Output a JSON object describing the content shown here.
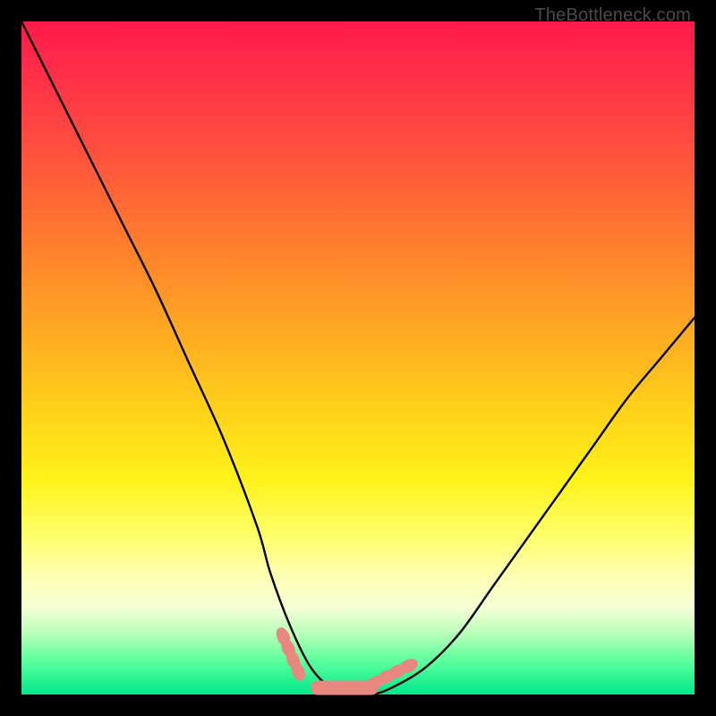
{
  "watermark": "TheBottleneck.com",
  "chart_data": {
    "type": "line",
    "title": "",
    "xlabel": "",
    "ylabel": "",
    "xlim": [
      0,
      100
    ],
    "ylim": [
      0,
      100
    ],
    "series": [
      {
        "name": "bottleneck-curve",
        "x": [
          0,
          5,
          10,
          15,
          20,
          25,
          30,
          35,
          37,
          40,
          43,
          46,
          49,
          52,
          55,
          60,
          65,
          70,
          75,
          80,
          85,
          90,
          95,
          100
        ],
        "values": [
          100,
          90,
          80,
          70,
          60,
          49,
          38,
          25,
          18,
          10,
          4,
          1,
          0,
          0,
          1,
          4,
          9,
          16,
          23,
          30,
          37,
          44,
          50,
          56
        ]
      }
    ],
    "markers": [
      {
        "name": "left-cluster",
        "x": 40,
        "y": 6
      },
      {
        "name": "right-cluster",
        "x": 55,
        "y": 3
      }
    ],
    "flat_segment": {
      "x_start": 43,
      "x_end": 53,
      "y": 1
    },
    "background_gradient": {
      "top": "#ff1a4b",
      "mid": "#ffd21a",
      "bottom": "#00e88a"
    }
  }
}
